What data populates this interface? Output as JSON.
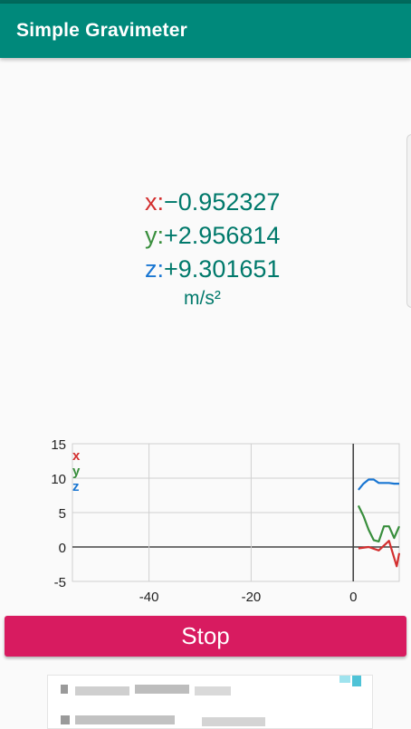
{
  "app": {
    "title": "Simple Gravimeter"
  },
  "readings": {
    "x": {
      "label": "x:",
      "value": "−0.952327",
      "color": "#d32f2f"
    },
    "y": {
      "label": "y:",
      "value": "+2.956814",
      "color": "#388e3c"
    },
    "z": {
      "label": "z:",
      "value": "+9.301651",
      "color": "#1976d2"
    },
    "unit": "m/s²"
  },
  "controls": {
    "stop_label": "Stop",
    "stop_color": "#d81b60"
  },
  "colors": {
    "app_bar": "#00897b",
    "value_text": "#00796b"
  },
  "chart_data": {
    "type": "line",
    "xlim": [
      -55,
      9
    ],
    "ylim": [
      -5,
      15
    ],
    "x_ticks": [
      -40,
      -20,
      0
    ],
    "x_tick_labels": [
      "-40",
      "-20",
      "0"
    ],
    "y_ticks": [
      15,
      10,
      5,
      0,
      -5
    ],
    "y_tick_labels": [
      "15",
      "10",
      "5",
      "0",
      "-5"
    ],
    "grid": true,
    "legend": "top-left",
    "series": [
      {
        "name": "x",
        "color": "#d32f2f",
        "x": [
          1,
          3,
          5,
          7,
          8.5,
          9
        ],
        "values": [
          -0.2,
          0,
          -0.5,
          0.9,
          -2.8,
          -0.9
        ]
      },
      {
        "name": "y",
        "color": "#388e3c",
        "x": [
          1,
          2,
          3,
          4,
          5,
          6,
          7,
          8,
          9
        ],
        "values": [
          6,
          4.5,
          2.5,
          1,
          0.8,
          3,
          3,
          1.3,
          3
        ]
      },
      {
        "name": "z",
        "color": "#1976d2",
        "x": [
          1,
          2,
          3,
          4,
          5,
          6,
          7,
          8,
          9
        ],
        "values": [
          8.3,
          9.2,
          9.8,
          9.8,
          9.3,
          9.3,
          9.3,
          9.2,
          9.2
        ]
      }
    ]
  }
}
